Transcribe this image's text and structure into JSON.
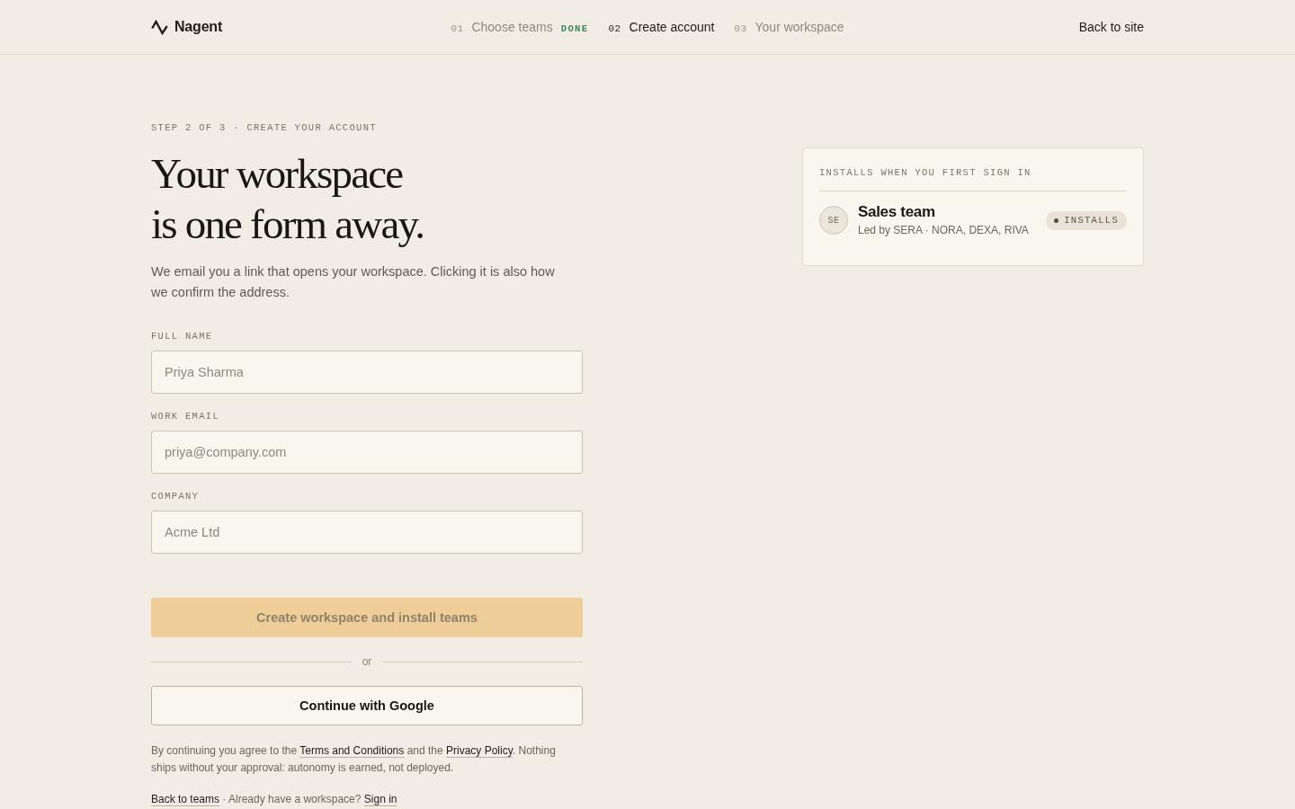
{
  "header": {
    "brand": "Nagent",
    "steps": [
      {
        "number": "01",
        "label": "Choose teams",
        "badge": "DONE",
        "selected": false
      },
      {
        "number": "02",
        "label": "Create account",
        "selected": true
      },
      {
        "number": "03",
        "label": "Your workspace",
        "selected": false
      }
    ],
    "back_link": "Back to site"
  },
  "form": {
    "eyebrow": "STEP 2 OF 3 · CREATE YOUR ACCOUNT",
    "title_lines": [
      "Your workspace",
      "is one form away."
    ],
    "intro": "We email you a link that opens your workspace. Clicking it is also how we confirm the address.",
    "fields": [
      {
        "label": "FULL NAME",
        "placeholder": "Priya Sharma"
      },
      {
        "label": "WORK EMAIL",
        "placeholder": "priya@company.com"
      },
      {
        "label": "COMPANY",
        "placeholder": "Acme Ltd"
      }
    ],
    "submit": {
      "label": "Create workspace and install teams",
      "disabled": true
    },
    "divider": "or",
    "google_button": "Continue with Google",
    "legal": [
      {
        "kind": "text",
        "text": "By continuing you agree to the "
      },
      {
        "kind": "link",
        "text": "Terms and Conditions"
      },
      {
        "kind": "text",
        "text": " and the "
      },
      {
        "kind": "link",
        "text": "Privacy Policy"
      },
      {
        "kind": "text",
        "text": ". Nothing ships without your approval: autonomy is earned, not deployed."
      }
    ],
    "footer": [
      {
        "kind": "link",
        "text": "Back to teams"
      },
      {
        "kind": "text",
        "text": " · Already have a workspace? "
      },
      {
        "kind": "link",
        "text": "Sign in"
      }
    ]
  },
  "installs_panel": {
    "title": "INSTALLS WHEN YOU FIRST SIGN IN",
    "teams": [
      {
        "initials": "SE",
        "name": "Sales team",
        "lead": "Led by SERA · NORA, DEXA, RIVA",
        "badge": "INSTALLS"
      }
    ]
  }
}
